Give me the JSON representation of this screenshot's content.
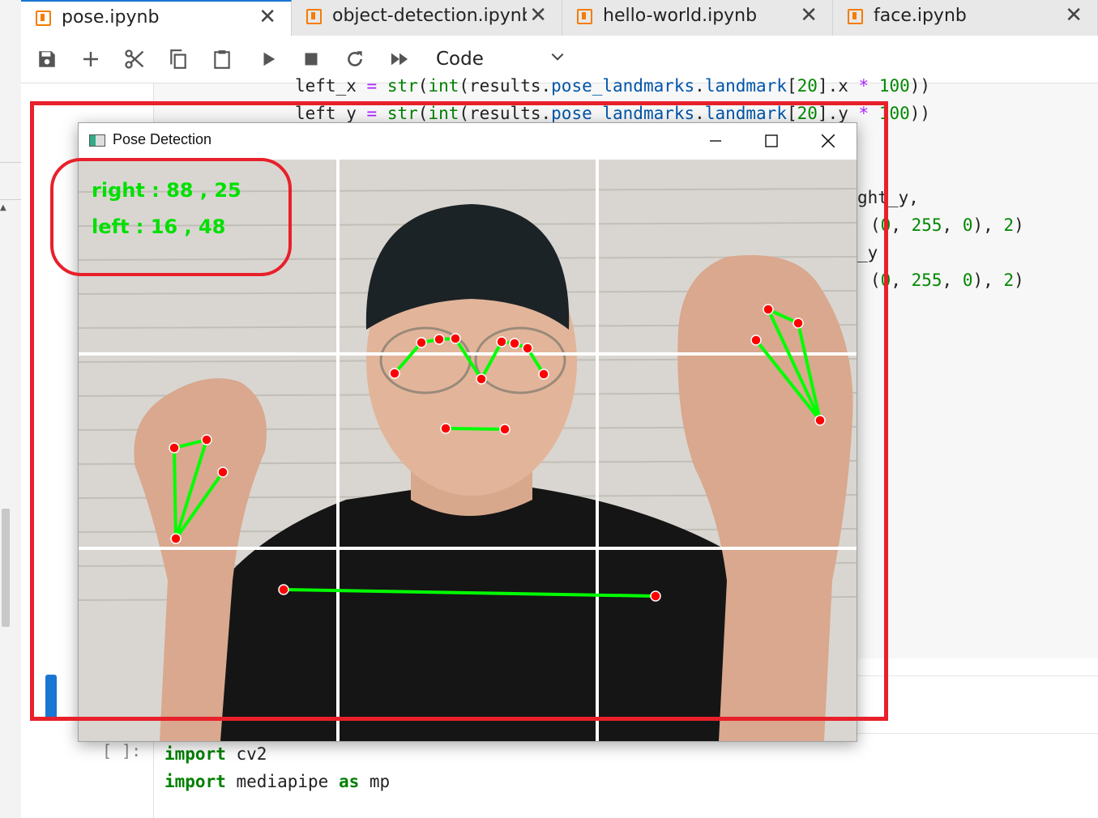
{
  "tabs": [
    {
      "label": "pose.ipynb",
      "active": true
    },
    {
      "label": "object-detection.ipynb",
      "active": false
    },
    {
      "label": "hello-world.ipynb",
      "active": false
    },
    {
      "label": "face.ipynb",
      "active": false
    }
  ],
  "toolbar": {
    "icons": [
      "save-icon",
      "add-icon",
      "cut-icon",
      "copy-icon",
      "paste-icon",
      "run-icon",
      "stop-icon",
      "restart-icon",
      "run-all-icon"
    ],
    "cell_type": "Code"
  },
  "code_cell": {
    "line1": {
      "a": "left_x ",
      "op": "=",
      "b": " ",
      "fn": "str",
      "c": "(",
      "fn2": "int",
      "d": "(results.",
      "at": "pose_landmarks",
      "e": ".",
      "at2": "landmark",
      "f": "[",
      "num": "20",
      "g": "].x ",
      "op2": "*",
      "h": " ",
      "num2": "100",
      "i": "))"
    },
    "line2": {
      "a": "left_y ",
      "op": "=",
      "b": " ",
      "fn": "str",
      "c": "(",
      "fn2": "int",
      "d": "(results.",
      "at": "pose_landmarks",
      "e": ".",
      "at2": "landmark",
      "f": "[",
      "num": "20",
      "g": "].y ",
      "op2": "*",
      "h": " ",
      "num2": "100",
      "i": "))"
    },
    "frag1": "ght_y,",
    "frag2a": "(",
    "frag2b": ", ",
    "frag2c": "255",
    "frag2d": ", ",
    "frag2e": "0",
    "frag2f": "), ",
    "frag2g": "2",
    "frag2h": ")",
    "frag3": "_y"
  },
  "next_cell": {
    "prompt": "[ ]:",
    "line1_kw": "import",
    "line1_rest": " cv2",
    "line2_kw": "import",
    "line2_mid": " mediapipe ",
    "line2_kw2": "as",
    "line2_rest": " mp"
  },
  "pose_window": {
    "title": "Pose Detection",
    "right_text": "right : 88 , 25",
    "left_text": "left : 16 , 48"
  },
  "colors": {
    "accent": "#1976d2",
    "annotation": "#e8202a",
    "overlay_green": "#00e000",
    "landmark_red": "#ff0000",
    "notebook_icon": "#f57c00"
  }
}
